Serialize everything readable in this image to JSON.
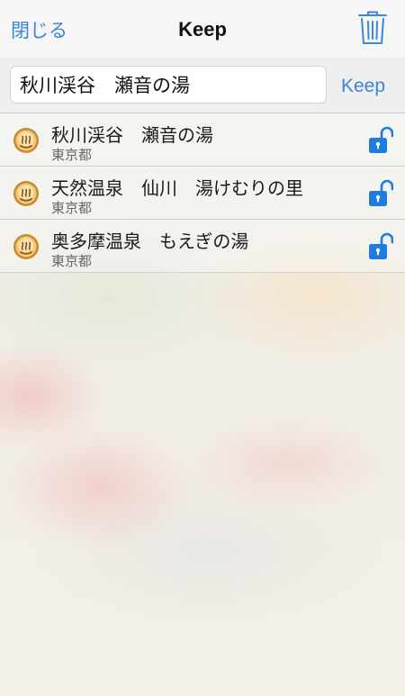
{
  "navbar": {
    "close_label": "閉じる",
    "title": "Keep",
    "trash_icon": "trash-icon"
  },
  "search": {
    "value": "秋川渓谷　瀬音の湯",
    "keep_label": "Keep"
  },
  "items": [
    {
      "title": "秋川渓谷　瀬音の湯",
      "subtitle": "東京都",
      "icon": "onsen-icon",
      "lock": "unlocked"
    },
    {
      "title": "天然温泉　仙川　湯けむりの里",
      "subtitle": "東京都",
      "icon": "onsen-icon",
      "lock": "unlocked"
    },
    {
      "title": "奥多摩温泉　もえぎの湯",
      "subtitle": "東京都",
      "icon": "onsen-icon",
      "lock": "unlocked"
    }
  ],
  "colors": {
    "accent": "#3b86d6",
    "lock_blue": "#1f7be0",
    "icon_gold": "#c98a2e"
  }
}
